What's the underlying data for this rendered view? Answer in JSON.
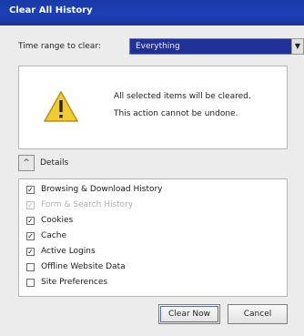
{
  "window": {
    "title": "Clear All History"
  },
  "range": {
    "label": "Time range to clear:",
    "selected": "Everything",
    "arrow": "▼"
  },
  "warning": {
    "icon": "warning-triangle-icon",
    "line1": "All selected items will be cleared.",
    "line2": "This action cannot be undone."
  },
  "details": {
    "toggle": "^",
    "label": "Details"
  },
  "items": [
    {
      "label": "Browsing & Download History",
      "checked": true,
      "disabled": false
    },
    {
      "label": "Form & Search History",
      "checked": true,
      "disabled": true
    },
    {
      "label": "Cookies",
      "checked": true,
      "disabled": false
    },
    {
      "label": "Cache",
      "checked": true,
      "disabled": false
    },
    {
      "label": "Active Logins",
      "checked": true,
      "disabled": false
    },
    {
      "label": "Offline Website Data",
      "checked": false,
      "disabled": false
    },
    {
      "label": "Site Preferences",
      "checked": false,
      "disabled": false
    }
  ],
  "buttons": {
    "clear": "Clear Now",
    "cancel": "Cancel"
  },
  "colors": {
    "titlebar": "#1d3fb6",
    "select_bg": "#21319a",
    "warning_yellow": "#f2cc2e"
  }
}
